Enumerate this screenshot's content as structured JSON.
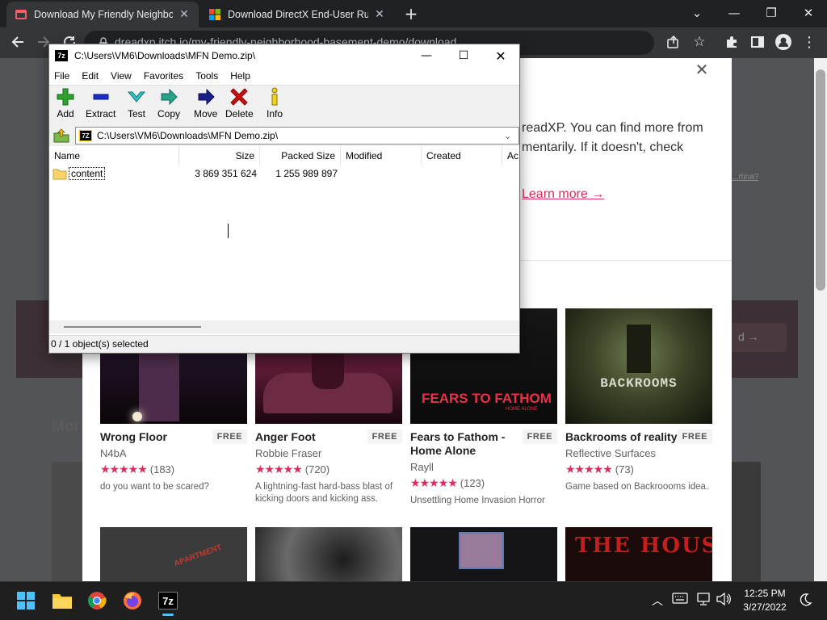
{
  "browser": {
    "tabs": [
      {
        "title": "Download My Friendly Neighborhood Basement Demo",
        "active": true
      },
      {
        "title": "Download DirectX End-User Runtime",
        "active": false
      }
    ],
    "new_tab_label": "+",
    "url": "dreadxp.itch.io/my-friendly-neighborhood-basement-demo/download"
  },
  "colors": {
    "accent": "#da2c5d",
    "star": "#da2c5d",
    "sevenzip_add": "#2ea12e",
    "sevenzip_delete": "#cc1010"
  },
  "page": {
    "modal": {
      "line1": "readXP. You can find more from",
      "line2": "mentarily. If it doesn't, check",
      "side_hint": "...rtina?",
      "learn_more": "Learn more →"
    },
    "more_label": "Mor",
    "band_button": "d →",
    "games": [
      {
        "title": "Wrong Floor",
        "price": "FREE",
        "author": "N4bA",
        "stars": 4.5,
        "rating_count": "(183)",
        "description": "do you want to be scared?"
      },
      {
        "title": "Anger Foot",
        "price": "FREE",
        "author": "Robbie Fraser",
        "stars": 5,
        "rating_count": "(720)",
        "description": "A lightning-fast hard-bass blast of kicking doors and kicking ass."
      },
      {
        "title": "Fears to Fathom - Home Alone",
        "price": "FREE",
        "author": "Rayll",
        "stars": 4.5,
        "rating_count": "(123)",
        "description": "Unsettling Home Invasion Horror",
        "thumb_text": "FEARS TO FATHOM",
        "thumb_sub": "HOME ALONE"
      },
      {
        "title": "Backrooms of reality",
        "price": "FREE",
        "author": "Reflective Surfaces",
        "stars": 4.5,
        "rating_count": "(73)",
        "description": "Game based on Backroooms idea.",
        "thumb_text": "BACKROOMS"
      }
    ],
    "row2_thumb_texts": [
      "APARTMENT",
      "",
      "",
      "THE HOUSE"
    ]
  },
  "sevenzip": {
    "title": "C:\\Users\\VM6\\Downloads\\MFN Demo.zip\\",
    "menu": [
      "File",
      "Edit",
      "View",
      "Favorites",
      "Tools",
      "Help"
    ],
    "toolbar": [
      {
        "label": "Add",
        "icon": "plus-icon"
      },
      {
        "label": "Extract",
        "icon": "minus-icon"
      },
      {
        "label": "Test",
        "icon": "check-icon"
      },
      {
        "label": "Copy",
        "icon": "double-arrow-icon"
      },
      {
        "label": "Move",
        "icon": "arrow-right-icon"
      },
      {
        "label": "Delete",
        "icon": "delete-x-icon"
      },
      {
        "label": "Info",
        "icon": "info-icon"
      }
    ],
    "address": "C:\\Users\\VM6\\Downloads\\MFN Demo.zip\\",
    "columns": [
      "Name",
      "Size",
      "Packed Size",
      "Modified",
      "Created",
      "Ac"
    ],
    "rows": [
      {
        "name": "content",
        "size": "3 869 351 624",
        "packed_size": "1 255 989 897",
        "modified": "",
        "created": ""
      }
    ],
    "status": "0 / 1 object(s) selected"
  },
  "taskbar": {
    "time": "12:25 PM",
    "date": "3/27/2022"
  }
}
